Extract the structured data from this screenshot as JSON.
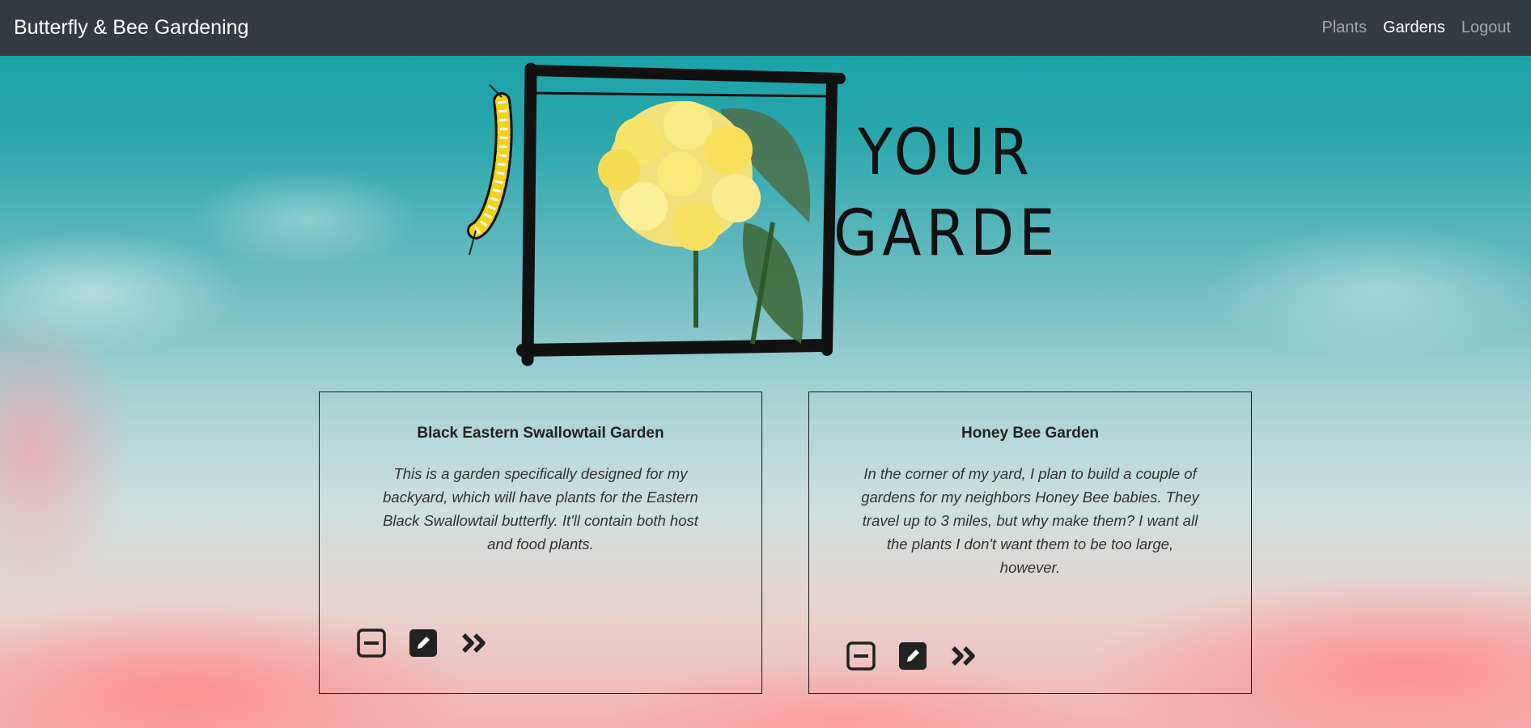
{
  "navbar": {
    "brand": "Butterfly & Bee Gardening",
    "links": [
      {
        "label": "Plants",
        "active": false
      },
      {
        "label": "Gardens",
        "active": true
      },
      {
        "label": "Logout",
        "active": false
      }
    ]
  },
  "hero": {
    "heading_line1": "YOUR",
    "heading_line2": "GARDENS"
  },
  "gardens": [
    {
      "title": "Black Eastern Swallowtail Garden",
      "description": "This is a garden specifically designed for my backyard, which will have plants for the Eastern Black Swallowtail butterfly. It'll contain both host and food plants.",
      "actions": [
        "minus-square-icon",
        "pencil-square-icon",
        "angle-double-right-icon"
      ]
    },
    {
      "title": "Honey Bee Garden",
      "description": "In the corner of my yard, I plan to build a couple of gardens for my neighbors Honey Bee babies. They travel up to 3 miles, but why make them? I want all the plants I don't want them to be too large, however.",
      "actions": [
        "minus-square-icon",
        "pencil-square-icon",
        "angle-double-right-icon"
      ]
    }
  ],
  "colors": {
    "navbar_bg": "#343a40",
    "sky_teal": "#109fa6",
    "cloud_pink": "#f3b2b0",
    "icon_dark": "#222222"
  }
}
